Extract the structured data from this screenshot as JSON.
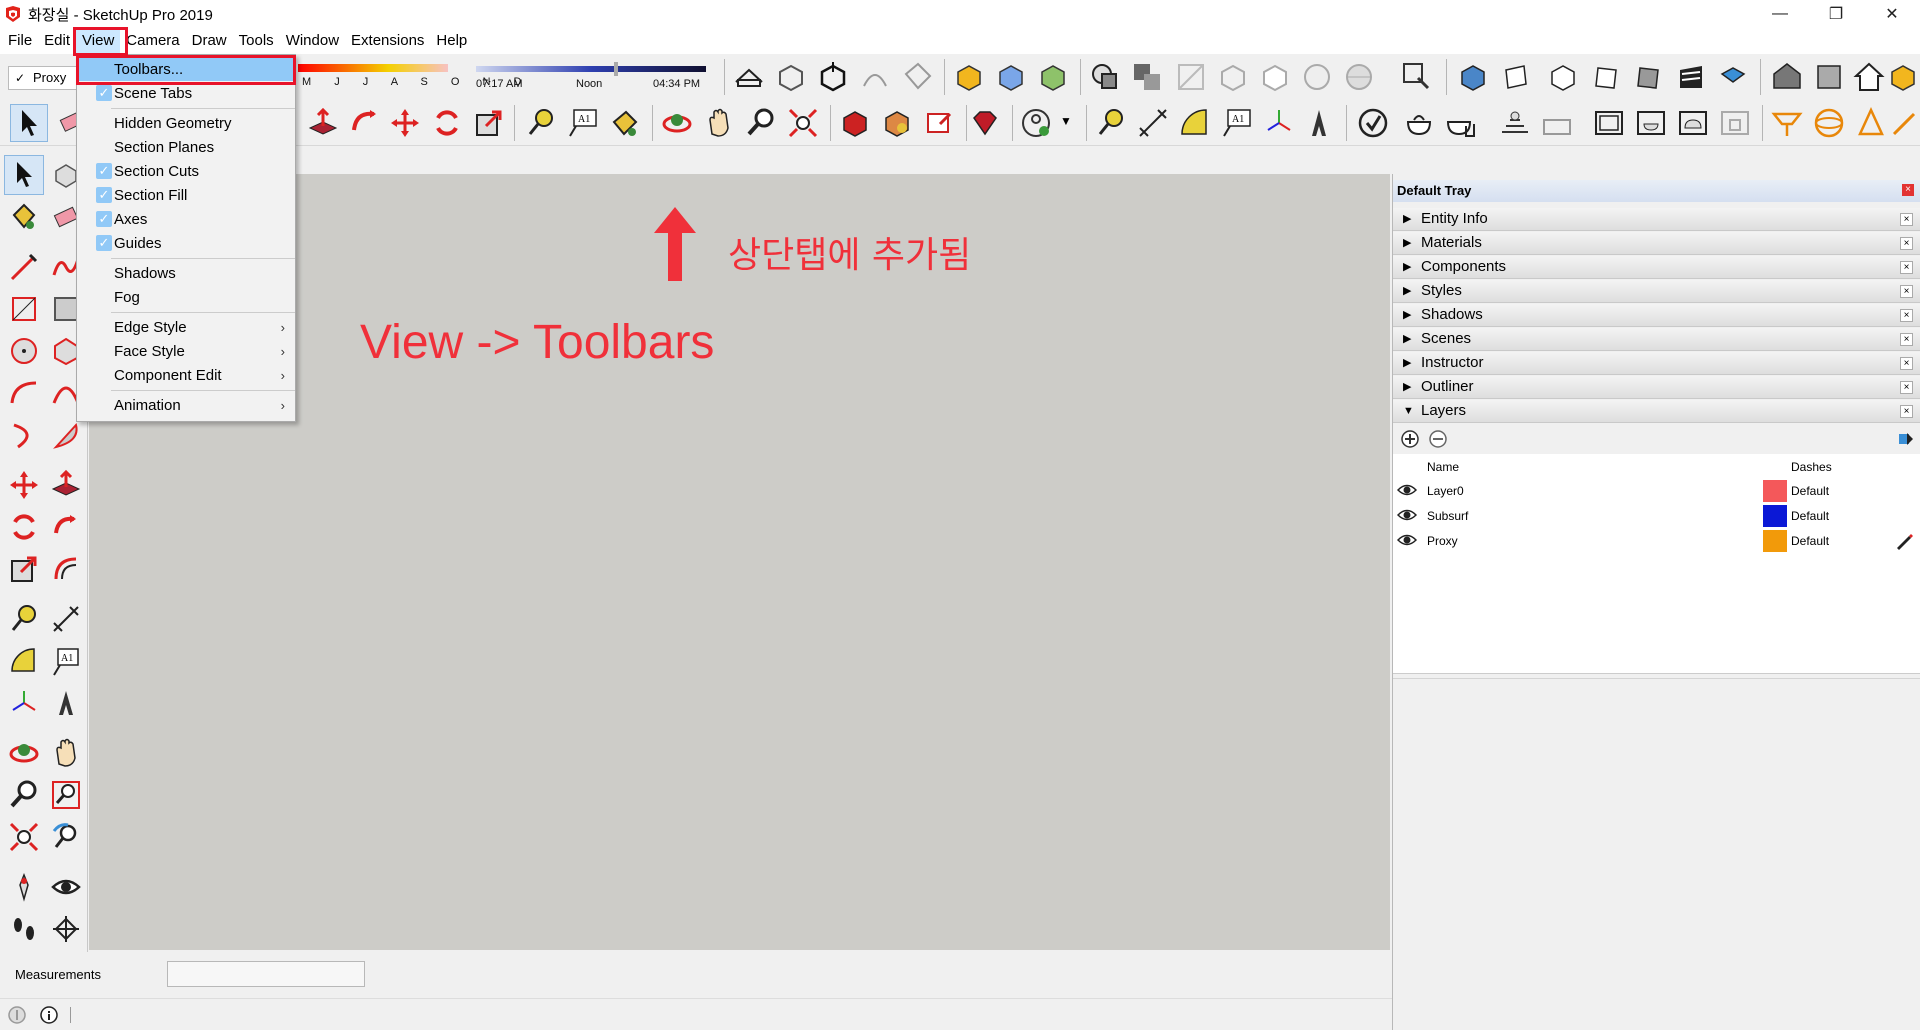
{
  "window": {
    "title": "화장실 - SketchUp Pro 2019",
    "minimize": "—",
    "restore": "❐",
    "close": "✕"
  },
  "menubar": [
    "File",
    "Edit",
    "View",
    "Camera",
    "Draw",
    "Tools",
    "Window",
    "Extensions",
    "Help"
  ],
  "toolbar": {
    "layer_dropdown": "Proxy",
    "months": "M J J A S O N D",
    "time_start": "07:17 AM",
    "time_noon": "Noon",
    "time_end": "04:34 PM"
  },
  "view_menu": {
    "items": [
      {
        "label": "Toolbars...",
        "checked": false,
        "submenu": false,
        "highlighted": true
      },
      {
        "label": "Scene Tabs",
        "checked": true,
        "submenu": false
      },
      {
        "label": "Hidden Geometry",
        "checked": false,
        "submenu": false
      },
      {
        "label": "Section Planes",
        "checked": false,
        "submenu": false
      },
      {
        "label": "Section Cuts",
        "checked": true,
        "submenu": false
      },
      {
        "label": "Section Fill",
        "checked": true,
        "submenu": false
      },
      {
        "label": "Axes",
        "checked": true,
        "submenu": false
      },
      {
        "label": "Guides",
        "checked": true,
        "submenu": false
      },
      {
        "label": "Shadows",
        "checked": false,
        "submenu": false
      },
      {
        "label": "Fog",
        "checked": false,
        "submenu": false
      },
      {
        "label": "Edge Style",
        "checked": false,
        "submenu": true
      },
      {
        "label": "Face Style",
        "checked": false,
        "submenu": true
      },
      {
        "label": "Component Edit",
        "checked": false,
        "submenu": true
      },
      {
        "label": "Animation",
        "checked": false,
        "submenu": true
      }
    ],
    "submenu_arrow": "›"
  },
  "annotations": {
    "korean": "상단탭에 추가됨",
    "main": "View -> Toolbars"
  },
  "tray": {
    "title": "Default Tray",
    "close": "×",
    "panels": [
      "Entity Info",
      "Materials",
      "Components",
      "Styles",
      "Shadows",
      "Scenes",
      "Instructor",
      "Outliner",
      "Layers"
    ],
    "layers": {
      "col_name": "Name",
      "col_dashes": "Dashes",
      "rows": [
        {
          "name": "Layer0",
          "color": "#f4585a",
          "dashes": "Default"
        },
        {
          "name": "Subsurf",
          "color": "#0b18d6",
          "dashes": "Default"
        },
        {
          "name": "Proxy",
          "color": "#f29a0a",
          "dashes": "Default"
        }
      ]
    }
  },
  "status": {
    "measurements": "Measurements"
  },
  "colors": {
    "accent_red": "#f0303a",
    "menu_highlight": "#91c9f7",
    "canvas": "#cdccc8"
  }
}
